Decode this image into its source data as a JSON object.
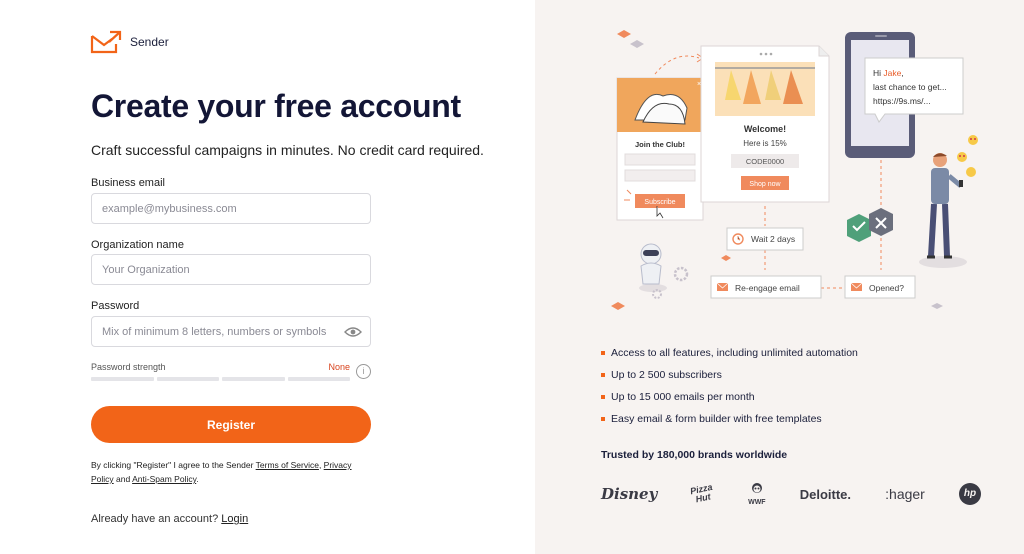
{
  "brand": {
    "name": "Sender",
    "accent": "#f26418"
  },
  "form": {
    "title": "Create your free account",
    "subtitle": "Craft successful campaigns in minutes. No credit card required.",
    "email": {
      "label": "Business email",
      "placeholder": "example@mybusiness.com",
      "value": ""
    },
    "organization": {
      "label": "Organization name",
      "placeholder": "Your Organization",
      "value": ""
    },
    "password": {
      "label": "Password",
      "placeholder": "Mix of minimum 8 letters, numbers or symbols",
      "value": "",
      "icon": "eye-icon"
    },
    "strength": {
      "label": "Password strength",
      "value": "None",
      "segments": 4
    },
    "register_label": "Register",
    "terms": {
      "prefix": "By clicking \"Register\" I agree to the Sender ",
      "terms_link": "Terms of Service",
      "comma": ", ",
      "privacy_link_1": "Privacy",
      "privacy_link_2": "Policy",
      "and": " and ",
      "antispam_link": "Anti-Spam Policy",
      "suffix": "."
    },
    "signin": {
      "prompt": "Already have an account? ",
      "link": "Login"
    }
  },
  "illustration": {
    "popup": {
      "title": "Join the Club!",
      "button": "Subscribe"
    },
    "email": {
      "title": "Welcome!",
      "offer": "Here is 15%",
      "code": "CODE0000",
      "button": "Shop now"
    },
    "sms": {
      "line1_prefix": "Hi ",
      "name": "Jake",
      "line1_suffix": ",",
      "line2": "last chance to get...",
      "line3": "https://9s.ms/..."
    },
    "wait": "Wait 2 days",
    "reengage": "Re-engage email",
    "opened": "Opened?"
  },
  "features": [
    "Access to all features, including unlimited automation",
    "Up to 2 500 subscribers",
    "Up to 15 000 emails per month",
    "Easy email & form builder with free templates"
  ],
  "trusted": "Trusted by 180,000 brands worldwide",
  "brands": {
    "disney": "Disney",
    "pizza_1": "Pizza",
    "pizza_2": "Hut",
    "wwf": "WWF",
    "deloitte": "Deloitte.",
    "hager": ":hager",
    "hp": "hp"
  }
}
